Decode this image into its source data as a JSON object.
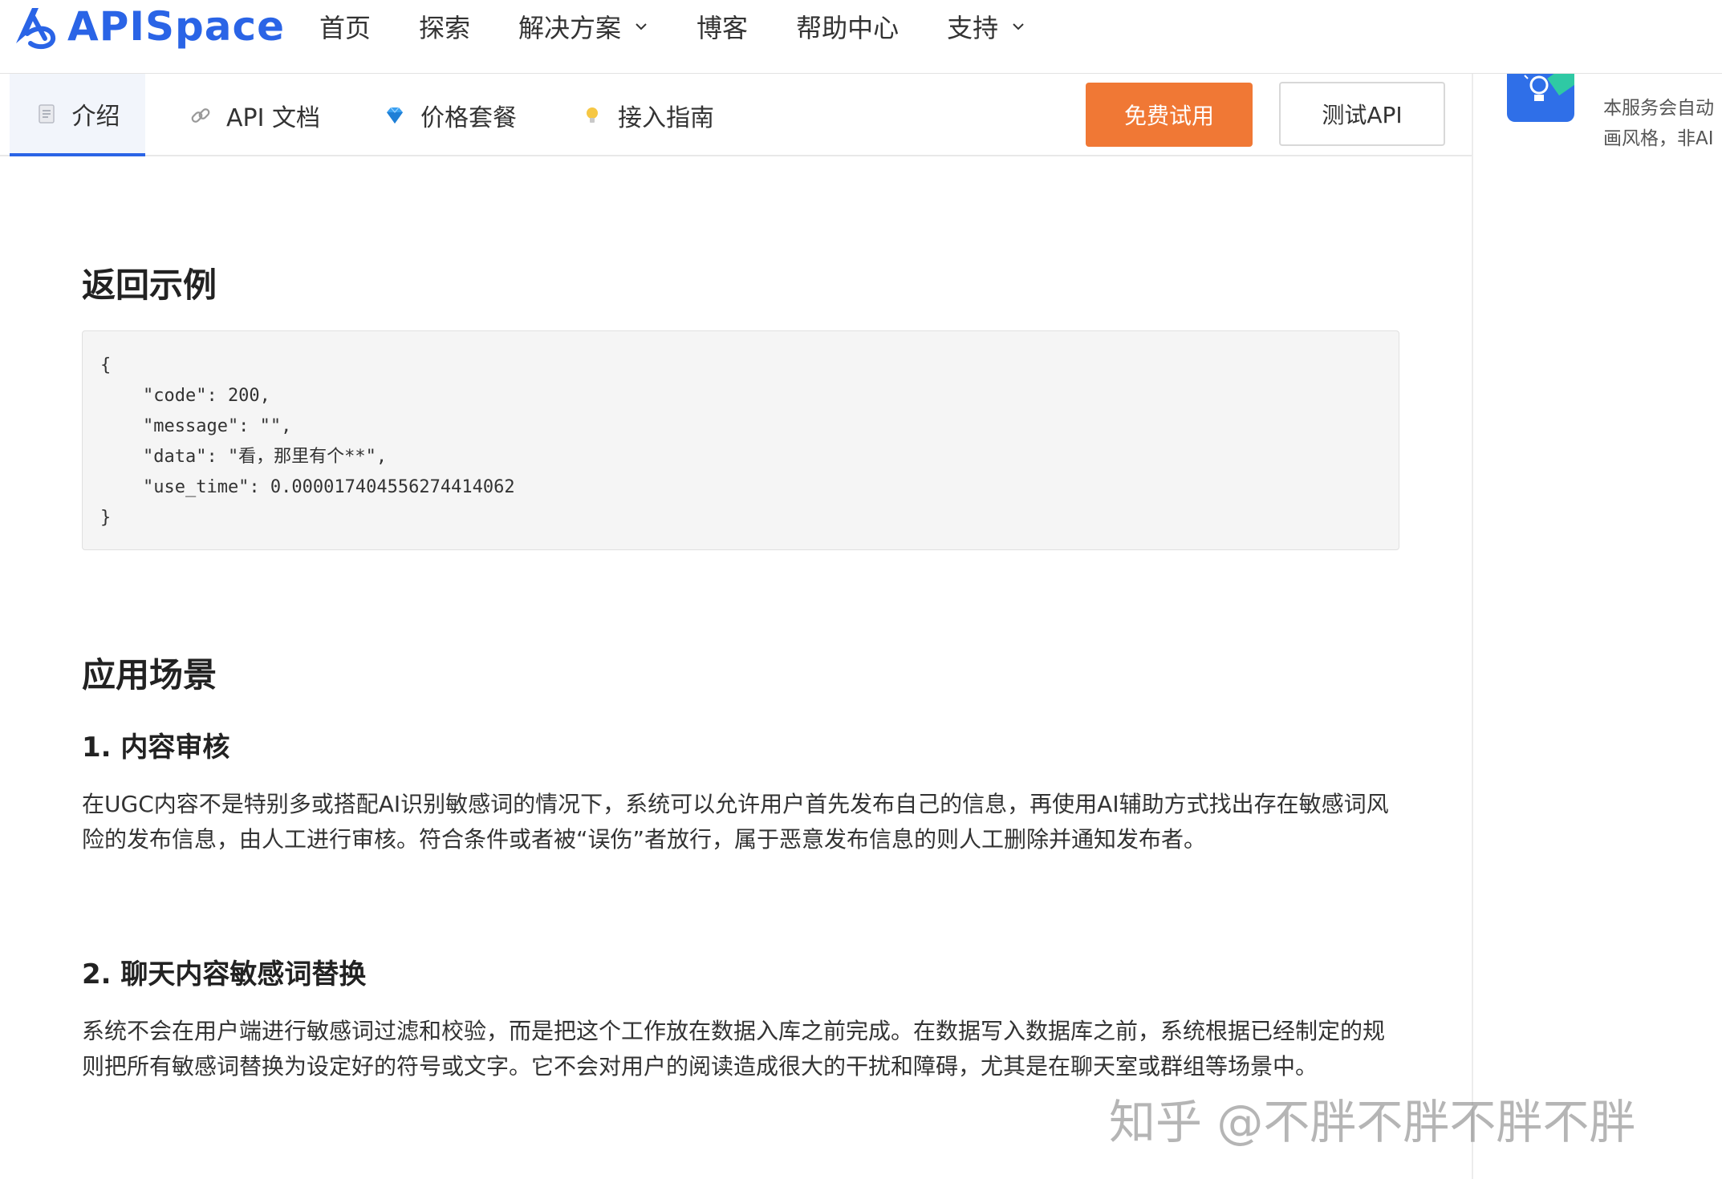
{
  "brand": {
    "name": "APISpace",
    "color": "#2a64e6"
  },
  "nav": {
    "items": [
      {
        "label": "首页",
        "dropdown": false
      },
      {
        "label": "探索",
        "dropdown": false
      },
      {
        "label": "解决方案",
        "dropdown": true
      },
      {
        "label": "博客",
        "dropdown": false
      },
      {
        "label": "帮助中心",
        "dropdown": false
      },
      {
        "label": "支持",
        "dropdown": true
      }
    ]
  },
  "tabs": [
    {
      "label": "介绍",
      "icon": "document-icon",
      "active": true
    },
    {
      "label": "API 文档",
      "icon": "link-icon",
      "active": false
    },
    {
      "label": "价格套餐",
      "icon": "diamond-icon",
      "active": false
    },
    {
      "label": "接入指南",
      "icon": "lightbulb-icon",
      "active": false
    }
  ],
  "actions": {
    "trial_label": "免费试用",
    "test_label": "测试API",
    "accent": "#f07835"
  },
  "side": {
    "line1": "本服务会自动",
    "line2": "画风格，非AI"
  },
  "content": {
    "response_heading": "返回示例",
    "code": "{\n    \"code\": 200,\n    \"message\": \"\",\n    \"data\": \"看，那里有个**\",\n    \"use_time\": 0.000017404556274414062\n}",
    "scenarios_heading": "应用场景",
    "s1_title": "1. 内容审核",
    "s1_text": "在UGC内容不是特别多或搭配AI识别敏感词的情况下，系统可以允许用户首先发布自己的信息，再使用AI辅助方式找出存在敏感词风险的发布信息，由人工进行审核。符合条件或者被“误伤”者放行，属于恶意发布信息的则人工删除并通知发布者。",
    "s2_title": "2. 聊天内容敏感词替换",
    "s2_text": "系统不会在用户端进行敏感词过滤和校验，而是把这个工作放在数据入库之前完成。在数据写入数据库之前，系统根据已经制定的规则把所有敏感词替换为设定好的符号或文字。它不会对用户的阅读造成很大的干扰和障碍，尤其是在聊天室或群组等场景中。"
  },
  "watermark": "知乎 @不胖不胖不胖不胖"
}
